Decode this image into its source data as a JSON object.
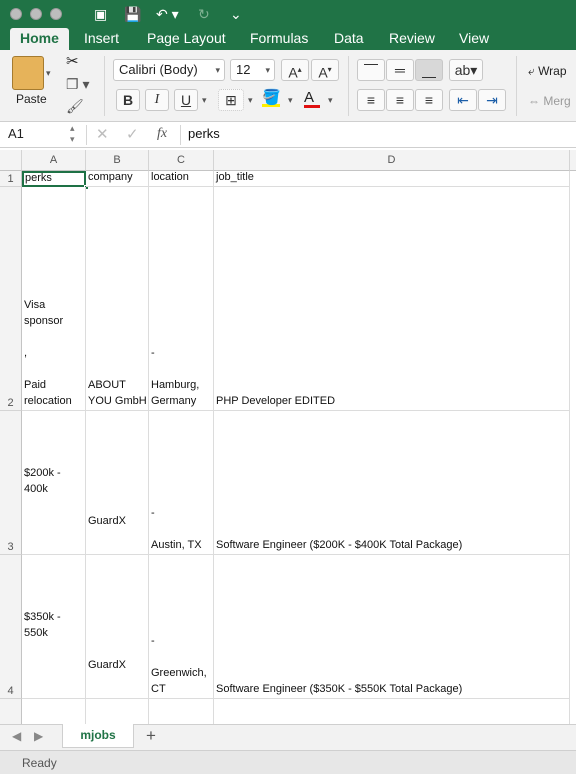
{
  "ribbon_tabs": [
    "Home",
    "Insert",
    "Page Layout",
    "Formulas",
    "Data",
    "Review",
    "View"
  ],
  "font": {
    "name": "Calibri (Body)",
    "size": "12"
  },
  "ribbon_labels": {
    "paste": "Paste",
    "wrap": "Wrap",
    "merge": "Merg"
  },
  "formula_bar": {
    "name_box": "A1",
    "fx": "fx",
    "content": "perks"
  },
  "columns": [
    "A",
    "B",
    "C",
    "D"
  ],
  "rows": [
    {
      "num": "1",
      "perks": "perks",
      "company": "company",
      "location": "location",
      "job_title": "job_title"
    },
    {
      "num": "2",
      "perks": "Visa\nsponsor\n\n,\n\nPaid\nrelocation",
      "company": "ABOUT\nYOU GmbH",
      "location": "-\n\nHamburg,\nGermany",
      "job_title": "PHP Developer EDITED"
    },
    {
      "num": "3",
      "perks": "$200k -\n400k",
      "company": "GuardX",
      "location": "-\n\nAustin, TX",
      "job_title": "Software Engineer ($200K - $400K Total Package)"
    },
    {
      "num": "4",
      "perks": "$350k -\n550k",
      "company": "GuardX",
      "location": "-\n\nGreenwich,\nCT",
      "job_title": "Software Engineer ($350K - $550K Total Package)"
    }
  ],
  "sheet_tab": "mjobs",
  "status": "Ready",
  "colors": {
    "accent": "#207346",
    "selection": "#1e7145"
  }
}
